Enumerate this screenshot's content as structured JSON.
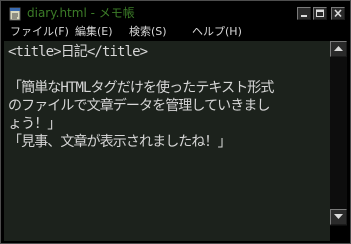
{
  "window": {
    "title": "diary.html - メモ帳",
    "icon": "notepad-icon",
    "buttons": [
      "minimize-icon",
      "maximize-icon",
      "close-icon"
    ]
  },
  "menu": {
    "file": "ファイル(F)",
    "edit": "編集(E)",
    "search": "検索(S)",
    "help": "ヘルプ(H)"
  },
  "editor": {
    "content": "<title>日記</title>\n\n「簡単なHTMLタグだけを使ったテキスト形式\nのファイルで文章データを管理していきまし\nょう！」\n「見事、文章が表示されましたね！」"
  },
  "colors": {
    "window_background": "#000000",
    "editor_background": "#1c221c",
    "text": "#d6d6d6",
    "title_text": "#3c7c28"
  }
}
